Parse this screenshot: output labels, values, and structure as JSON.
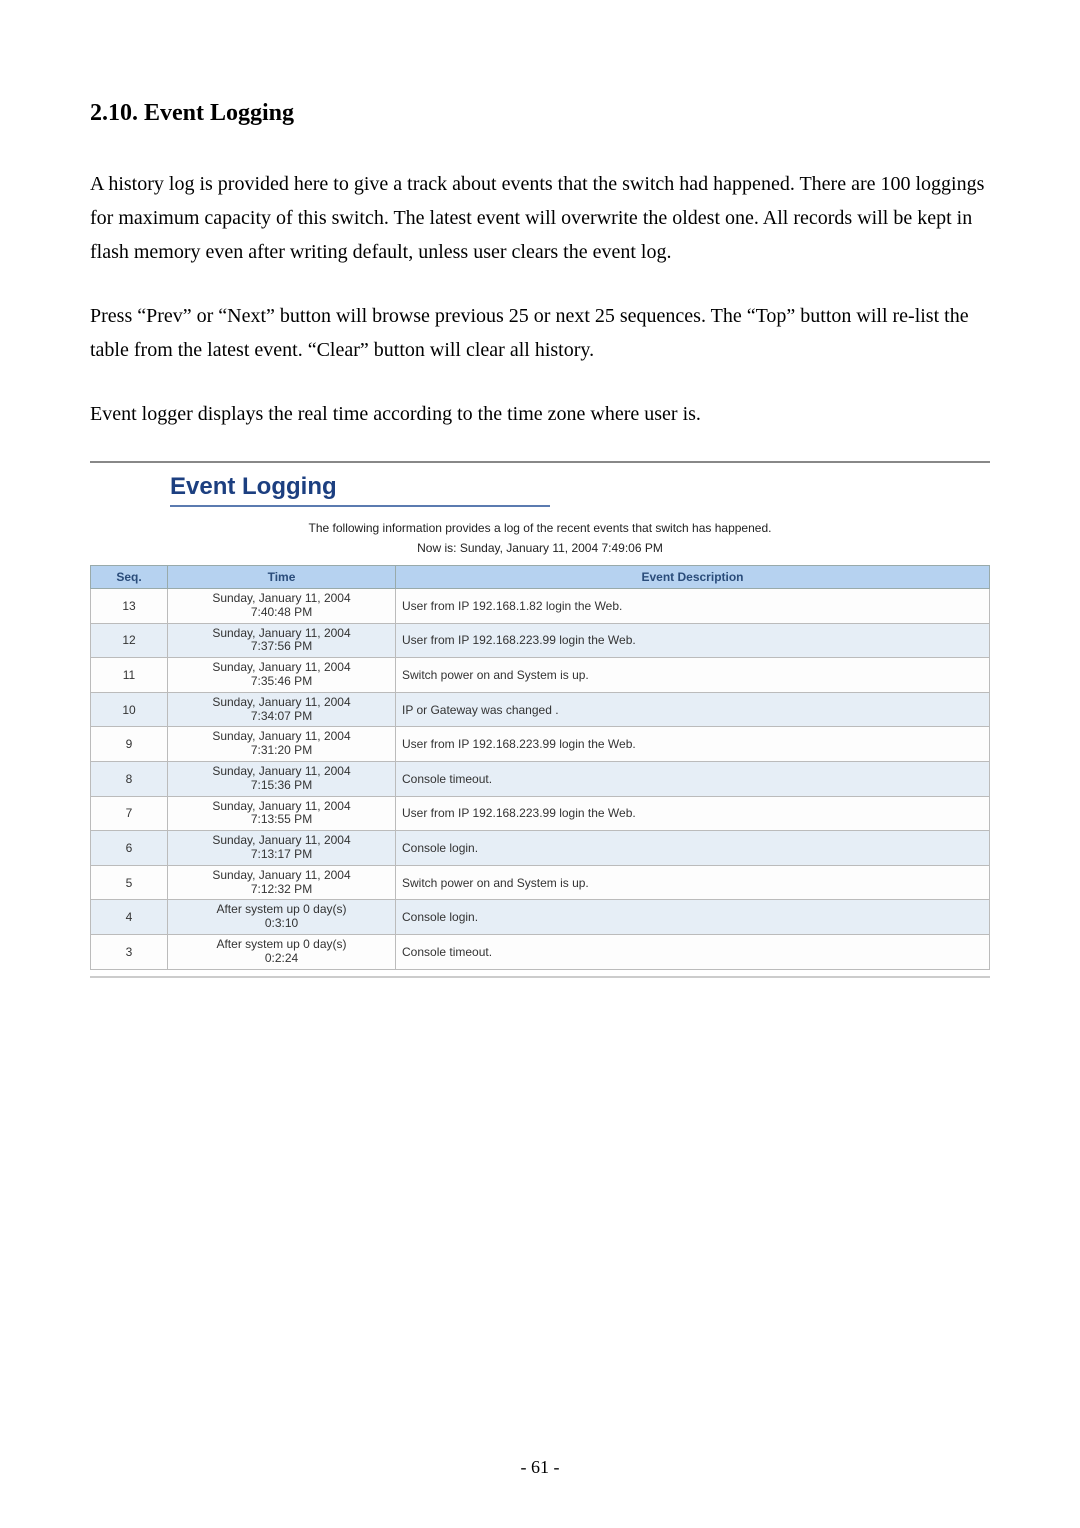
{
  "doc": {
    "heading": "2.10. Event Logging",
    "para1": "A history log is provided here to give a track about events that the switch had happened. There are 100 loggings for maximum capacity of this switch. The latest event will overwrite the oldest one. All records will be kept in flash memory even after writing default, unless user clears the event log.",
    "para2": "Press “Prev” or “Next” button will browse previous 25 or next 25 sequences. The “Top” button will re-list the table from the latest event. “Clear” button will clear all history.",
    "para3": "Event logger displays the real time according to the time zone where user is.",
    "page_number": "- 61 -"
  },
  "screenshot": {
    "title": "Event Logging",
    "sub1": "The following information provides a log of the recent events that switch has happened.",
    "sub2": "Now is: Sunday, January 11, 2004 7:49:06 PM",
    "headers": {
      "seq": "Seq.",
      "time": "Time",
      "desc": "Event Description"
    },
    "rows": [
      {
        "seq": "13",
        "time_l1": "Sunday, January 11, 2004",
        "time_l2": "7:40:48 PM",
        "desc": "User from IP 192.168.1.82 login the Web."
      },
      {
        "seq": "12",
        "time_l1": "Sunday, January 11, 2004",
        "time_l2": "7:37:56 PM",
        "desc": "User from IP 192.168.223.99 login the Web."
      },
      {
        "seq": "11",
        "time_l1": "Sunday, January 11, 2004",
        "time_l2": "7:35:46 PM",
        "desc": "Switch power on and System is up."
      },
      {
        "seq": "10",
        "time_l1": "Sunday, January 11, 2004",
        "time_l2": "7:34:07 PM",
        "desc": "IP or Gateway was changed ."
      },
      {
        "seq": "9",
        "time_l1": "Sunday, January 11, 2004",
        "time_l2": "7:31:20 PM",
        "desc": "User from IP 192.168.223.99 login the Web."
      },
      {
        "seq": "8",
        "time_l1": "Sunday, January 11, 2004",
        "time_l2": "7:15:36 PM",
        "desc": "Console timeout."
      },
      {
        "seq": "7",
        "time_l1": "Sunday, January 11, 2004",
        "time_l2": "7:13:55 PM",
        "desc": "User from IP 192.168.223.99 login the Web."
      },
      {
        "seq": "6",
        "time_l1": "Sunday, January 11, 2004",
        "time_l2": "7:13:17 PM",
        "desc": "Console login."
      },
      {
        "seq": "5",
        "time_l1": "Sunday, January 11, 2004",
        "time_l2": "7:12:32 PM",
        "desc": "Switch power on and System is up."
      },
      {
        "seq": "4",
        "time_l1": "After system up 0 day(s)",
        "time_l2": "0:3:10",
        "desc": "Console login."
      },
      {
        "seq": "3",
        "time_l1": "After system up 0 day(s)",
        "time_l2": "0:2:24",
        "desc": "Console timeout."
      }
    ]
  }
}
